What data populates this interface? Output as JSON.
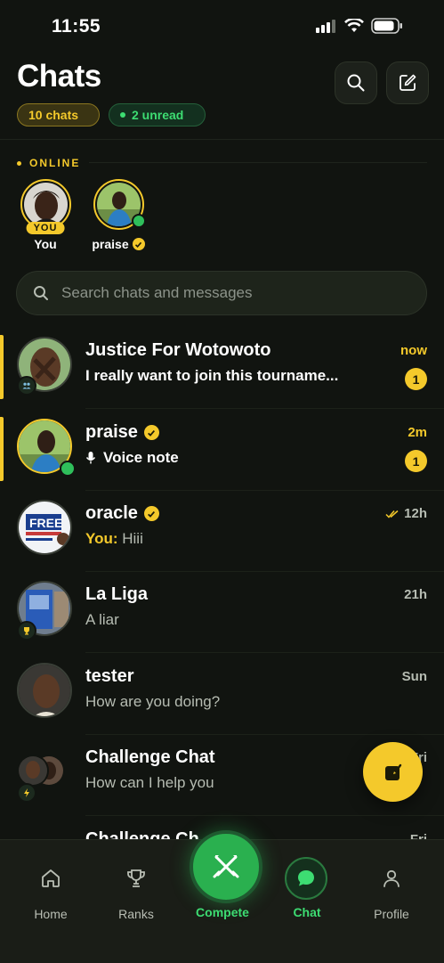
{
  "status_bar": {
    "time": "11:55"
  },
  "header": {
    "title": "Chats",
    "chats_count": "10 chats",
    "unread_count": "2 unread"
  },
  "online": {
    "label": "ONLINE",
    "users": [
      {
        "name": "You",
        "badge": "YOU"
      },
      {
        "name": "praise",
        "verified": true
      }
    ]
  },
  "search": {
    "placeholder": "Search chats and messages"
  },
  "chats": [
    {
      "name": "Justice For Wotowoto",
      "preview": "I really want to join this tourname...",
      "time": "now",
      "unread": "1",
      "type": "group"
    },
    {
      "name": "praise",
      "verified": true,
      "preview": "Voice note",
      "time": "2m",
      "unread": "1",
      "online": true
    },
    {
      "name": "oracle",
      "verified": true,
      "preview_prefix": "You:",
      "preview": "Hiii",
      "time": "12h",
      "read": true
    },
    {
      "name": "La Liga",
      "preview": "A liar",
      "time": "21h",
      "type": "league"
    },
    {
      "name": "tester",
      "preview": "How are you doing?",
      "time": "Sun"
    },
    {
      "name": "Challenge Chat",
      "preview": "How can I help you",
      "time": "Fri",
      "type": "challenge"
    },
    {
      "name": "Challenge Ch",
      "preview": "",
      "time": "Fri"
    }
  ],
  "avatars": {
    "photo": "IMAGE (photo)",
    "poster_text": "FREE"
  },
  "tabs": [
    {
      "label": "Home",
      "icon": "home-icon"
    },
    {
      "label": "Ranks",
      "icon": "trophy-icon"
    },
    {
      "label": "Compete",
      "icon": "crossed-swords-icon"
    },
    {
      "label": "Chat",
      "icon": "chat-bubble-icon"
    },
    {
      "label": "Profile",
      "icon": "person-icon"
    }
  ],
  "colors": {
    "accent": "#f4c92b",
    "green": "#3ddc72",
    "bg": "#111410"
  }
}
